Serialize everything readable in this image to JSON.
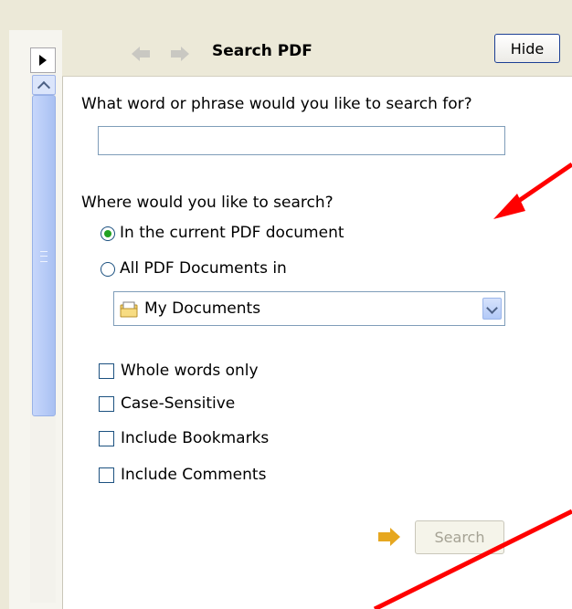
{
  "header": {
    "title": "Search PDF",
    "hide_label": "Hide"
  },
  "search": {
    "question": "What word or phrase would you like to search for?",
    "input_value": "",
    "where_label": "Where would you like to search?",
    "options": [
      {
        "label": "In the current PDF document",
        "selected": true
      },
      {
        "label": "All PDF Documents in",
        "selected": false
      }
    ],
    "location": "My Documents",
    "checkboxes": [
      {
        "label": "Whole words only",
        "checked": false
      },
      {
        "label": "Case-Sensitive",
        "checked": false
      },
      {
        "label": "Include Bookmarks",
        "checked": false
      },
      {
        "label": "Include Comments",
        "checked": false
      }
    ],
    "search_button": "Search"
  },
  "colors": {
    "annotation_arrow": "#ff0000",
    "accent_arrow": "#e6a720",
    "radio_dot": "#21a121"
  },
  "icons": [
    "expand-arrow-icon",
    "scroll-up-icon",
    "back-arrow-icon",
    "forward-arrow-icon",
    "folder-icon",
    "dropdown-chevron-icon",
    "go-arrow-icon"
  ]
}
